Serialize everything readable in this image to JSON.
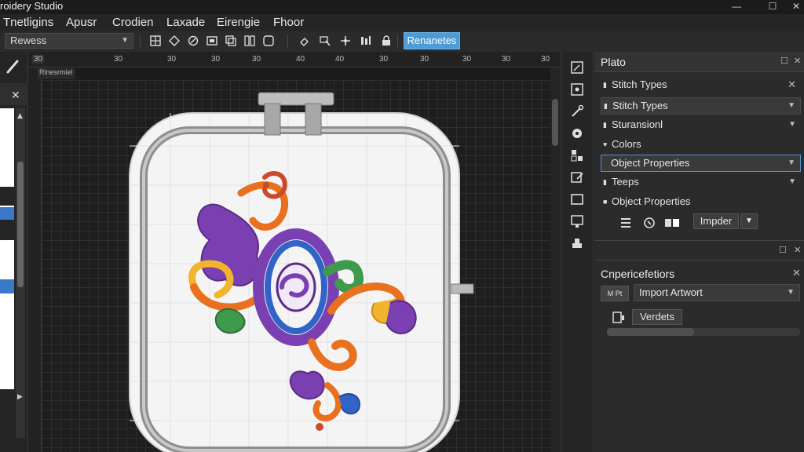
{
  "app": {
    "title": "roidery Studio",
    "window_controls": {
      "minimize": "—",
      "maximize": "☐",
      "close": "✕"
    }
  },
  "menu": [
    "Tnetligins",
    "Apusr",
    "Crodien",
    "Laxade",
    "Eirengie",
    "Fhoor"
  ],
  "toolbar": {
    "preset_value": "Rewess",
    "highlight_button": "Renanetes"
  },
  "canvas": {
    "ruler_numbers": [
      "30",
      "30",
      "30",
      "30",
      "30",
      "40",
      "40",
      "30",
      "30",
      "30",
      "30",
      "30"
    ],
    "doc_tab": "Rlnesrmiel"
  },
  "panels": {
    "top": {
      "title": "Plato",
      "section_title": "Stitch Types",
      "rows": [
        {
          "label": "Stitch Types",
          "kind": "dropdown"
        },
        {
          "label": "Sturansionl",
          "kind": "dropdown"
        },
        {
          "label": "Colors",
          "kind": "text"
        },
        {
          "label": "Object Properties",
          "kind": "dropdown-selected"
        },
        {
          "label": "Teeps",
          "kind": "dropdown"
        }
      ],
      "object_properties_label": "Object Properties",
      "impder_button": "Impder"
    },
    "bottom": {
      "title": "Cnpericefetiors",
      "mini_label": "M Pt",
      "import_dropdown": "Import Artwort",
      "verdets_button": "Verdets",
      "progress": 0.45
    }
  },
  "colors": {
    "accent": "#4e9cd6",
    "embroidery_purple": "#7a3fb0",
    "embroidery_orange": "#e8701e",
    "embroidery_green": "#3f9a4e",
    "embroidery_blue": "#3264c8",
    "embroidery_yellow": "#f2b42e"
  }
}
